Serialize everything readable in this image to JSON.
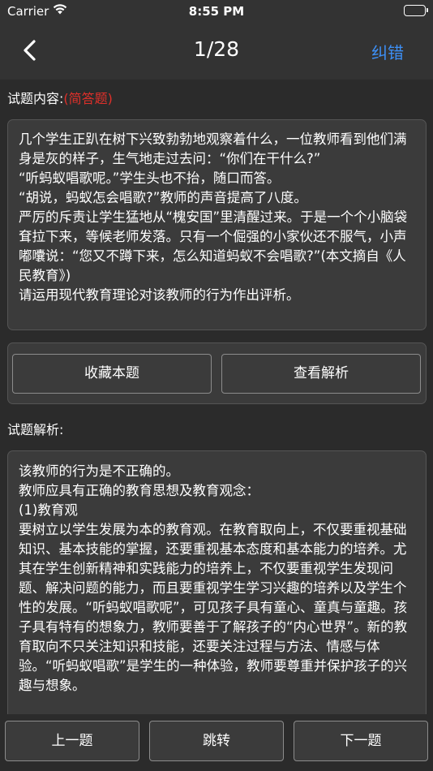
{
  "status": {
    "carrier": "Carrier",
    "time": "8:55 PM"
  },
  "nav": {
    "title": "1/28",
    "report_label": "纠错"
  },
  "question": {
    "label": "试题内容:",
    "type": "(简答题)",
    "text": "几个学生正趴在树下兴致勃勃地观察着什么，一位教师看到他们满身是灰的样子，生气地走过去问：“你们在干什么?”\n“听蚂蚁唱歌呢。”学生头也不抬，随口而答。\n“胡说，蚂蚁怎会唱歌?”教师的声音提高了八度。\n严厉的斥责让学生猛地从“槐安国”里清醒过来。于是一个个小脑袋耷拉下来，等候老师发落。只有一个倔强的小家伙还不服气，小声嘟囔说：“您又不蹲下来，怎么知道蚂蚁不会唱歌?”(本文摘自《人民教育》)\n请运用现代教育理论对该教师的行为作出评析。"
  },
  "actions": {
    "favorite_label": "收藏本题",
    "view_analysis_label": "查看解析"
  },
  "analysis": {
    "label": "试题解析:",
    "text": "该教师的行为是不正确的。\n教师应具有正确的教育思想及教育观念：\n(1)教育观\n要树立以学生发展为本的教育观。在教育取向上，不仅要重视基础知识、基本技能的掌握，还要重视基本态度和基本能力的培养。尤其在学生创新精神和实践能力的培养上，不仅要重视学生发现问题、解决问题的能力，而且要重视学生学习兴趣的培养以及学生个性的发展。“听蚂蚁唱歌呢”，可见孩子具有童心、童真与童趣。孩子具有特有的想象力，教师要善于了解孩子的“内心世界”。新的教育取向不只关注知识和技能，还要关注过程与方法、情感与体验。“听蚂蚁唱歌”是学生的一种体验，教师要尊重并保护孩子的兴趣与想象。"
  },
  "bottom": {
    "prev_label": "上一题",
    "jump_label": "跳转",
    "next_label": "下一题"
  },
  "colors": {
    "accent": "#3d8ff5",
    "question_type": "#e0302a",
    "background": "#2b2b2b",
    "panel": "#3b3b3b"
  },
  "icons": {
    "back": "chevron-left-icon",
    "wifi": "wifi-icon",
    "battery": "battery-icon"
  }
}
